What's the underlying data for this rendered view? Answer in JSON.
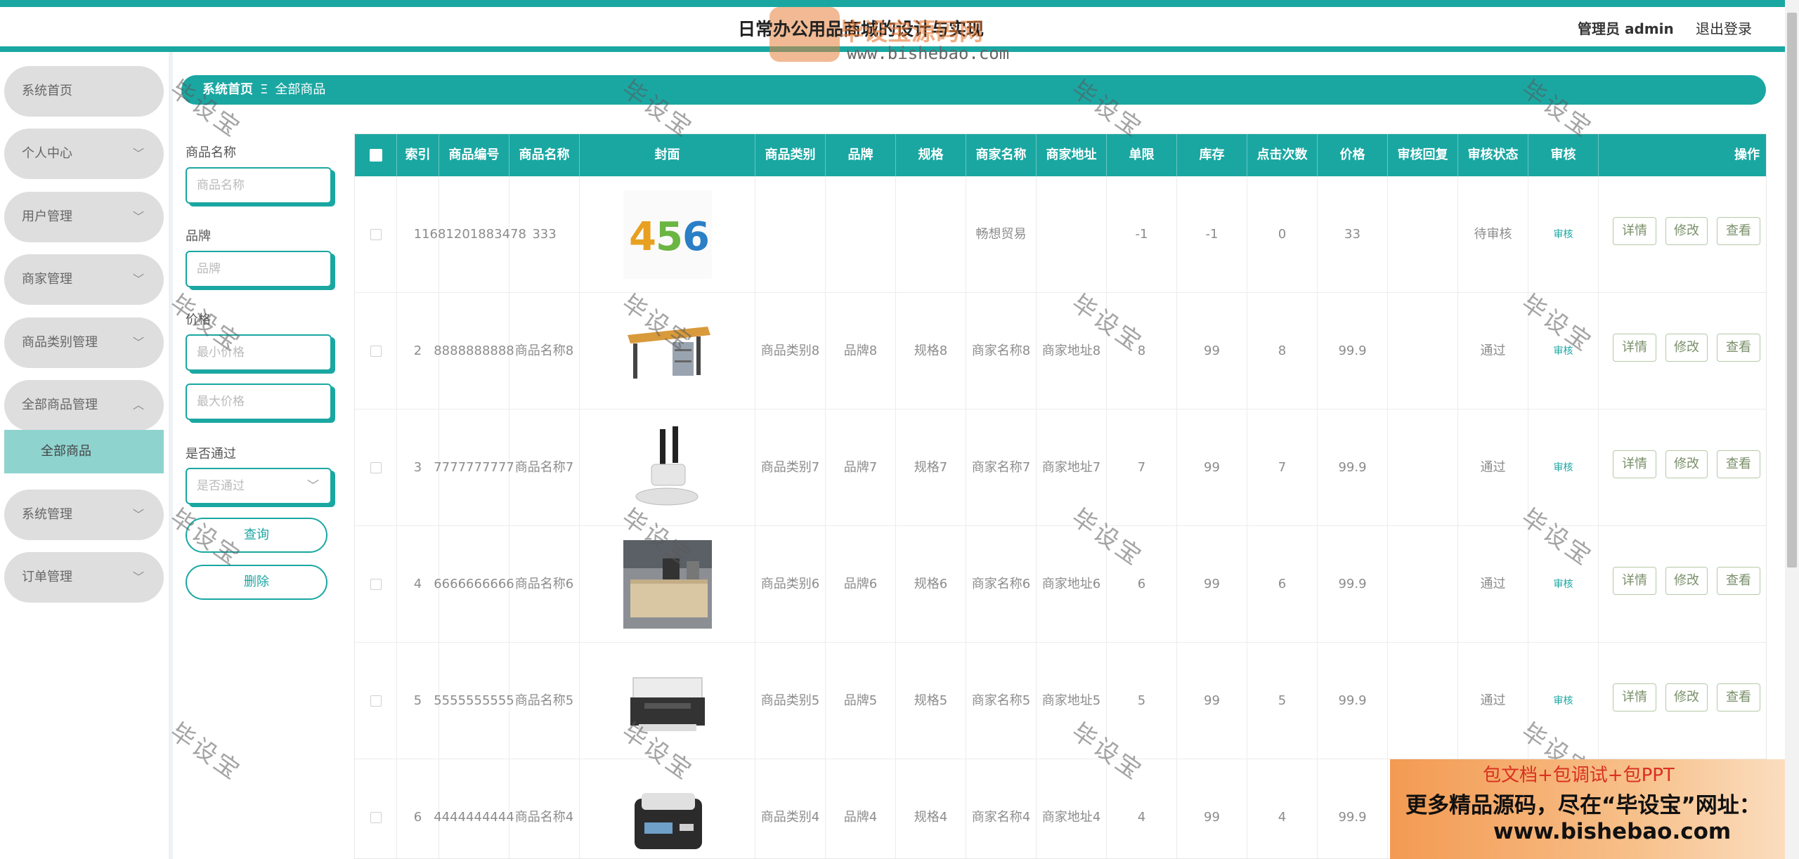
{
  "header": {
    "title": "日常办公用品商城的设计与实现",
    "admin_label": "管理员 admin",
    "logout_label": "退出登录",
    "watermark_brand": "毕设宝源码网",
    "watermark_url": "www.bishebao.com"
  },
  "sidebar": {
    "items": [
      {
        "label": "系统首页"
      },
      {
        "label": "个人中心"
      },
      {
        "label": "用户管理"
      },
      {
        "label": "商家管理"
      },
      {
        "label": "商品类别管理"
      },
      {
        "label": "全部商品管理"
      },
      {
        "label": "系统管理"
      },
      {
        "label": "订单管理"
      }
    ],
    "subitem": "全部商品"
  },
  "breadcrumb": {
    "home": "系统首页",
    "separator": "Ξ",
    "current": "全部商品"
  },
  "filters": {
    "name_label": "商品名称",
    "name_placeholder": "商品名称",
    "brand_label": "品牌",
    "brand_placeholder": "品牌",
    "price_label": "价格",
    "min_price_placeholder": "最小价格",
    "max_price_placeholder": "最大价格",
    "pass_label": "是否通过",
    "pass_placeholder": "是否通过",
    "query_button": "查询",
    "delete_button": "删除"
  },
  "table": {
    "columns": [
      "索引",
      "商品编号",
      "商品名称",
      "封面",
      "商品类别",
      "品牌",
      "规格",
      "商家名称",
      "商家地址",
      "单限",
      "库存",
      "点击次数",
      "价格",
      "审核回复",
      "审核状态",
      "审核",
      "操作"
    ],
    "audit_link": "审核",
    "actions": [
      "详情",
      "修改",
      "查看"
    ],
    "rows": [
      {
        "index": "1",
        "code": "1681201883478",
        "name": "333",
        "cover": "numbers-456",
        "category": "",
        "brand": "",
        "spec": "",
        "merchant": "畅想贸易",
        "address": "",
        "limit": "-1",
        "stock": "-1",
        "clicks": "0",
        "price": "33",
        "reply": "",
        "status": "待审核"
      },
      {
        "index": "2",
        "code": "8888888888",
        "name": "商品名称8",
        "cover": "office-desk",
        "category": "商品类别8",
        "brand": "品牌8",
        "spec": "规格8",
        "merchant": "商家名称8",
        "address": "商家地址8",
        "limit": "8",
        "stock": "99",
        "clicks": "8",
        "price": "99.9",
        "reply": "",
        "status": "通过"
      },
      {
        "index": "3",
        "code": "7777777777",
        "name": "商品名称7",
        "cover": "binding-machine",
        "category": "商品类别7",
        "brand": "品牌7",
        "spec": "规格7",
        "merchant": "商家名称7",
        "address": "商家地址7",
        "limit": "7",
        "stock": "99",
        "clicks": "7",
        "price": "99.9",
        "reply": "",
        "status": "通过"
      },
      {
        "index": "4",
        "code": "6666666666",
        "name": "商品名称6",
        "cover": "executive-desk",
        "category": "商品类别6",
        "brand": "品牌6",
        "spec": "规格6",
        "merchant": "商家名称6",
        "address": "商家地址6",
        "limit": "6",
        "stock": "99",
        "clicks": "6",
        "price": "99.9",
        "reply": "",
        "status": "通过"
      },
      {
        "index": "5",
        "code": "5555555555",
        "name": "商品名称5",
        "cover": "printer",
        "category": "商品类别5",
        "brand": "品牌5",
        "spec": "规格5",
        "merchant": "商家名称5",
        "address": "商家地址5",
        "limit": "5",
        "stock": "99",
        "clicks": "5",
        "price": "99.9",
        "reply": "",
        "status": "通过"
      },
      {
        "index": "6",
        "code": "4444444444",
        "name": "商品名称4",
        "cover": "money-counter",
        "category": "商品类别4",
        "brand": "品牌4",
        "spec": "规格4",
        "merchant": "商家名称4",
        "address": "商家地址4",
        "limit": "4",
        "stock": "99",
        "clicks": "4",
        "price": "99.9",
        "reply": "",
        "status": ""
      }
    ]
  },
  "watermark_text": "毕设宝",
  "ad": {
    "line1": "包文档+包调试+包PPT",
    "line2": "更多精品源码，尽在“毕设宝”网址：",
    "line3": "www.bishebao.com"
  },
  "colors": {
    "accent": "#1aa7a2",
    "submenu_active": "#8fd3cf",
    "menu_bg": "#dedede"
  }
}
